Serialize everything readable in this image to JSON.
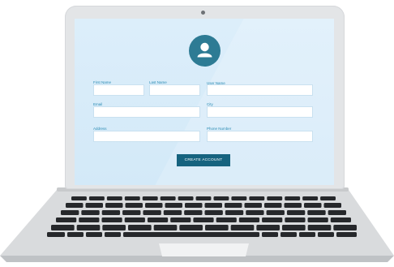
{
  "form": {
    "first_name_label": "First Name",
    "last_name_label": "Last Name",
    "user_name_label": "User Name",
    "email_label": "Email",
    "city_label": "City",
    "address_label": "Address",
    "phone_label": "Phone Number",
    "submit_label": "CREATE ACCOUNT"
  },
  "colors": {
    "accent": "#16637f",
    "avatar": "#2d7b94",
    "screen_bg": "#d7ebf9",
    "label": "#2a8bb3"
  },
  "icons": [
    "user-avatar-icon",
    "webcam-icon"
  ]
}
